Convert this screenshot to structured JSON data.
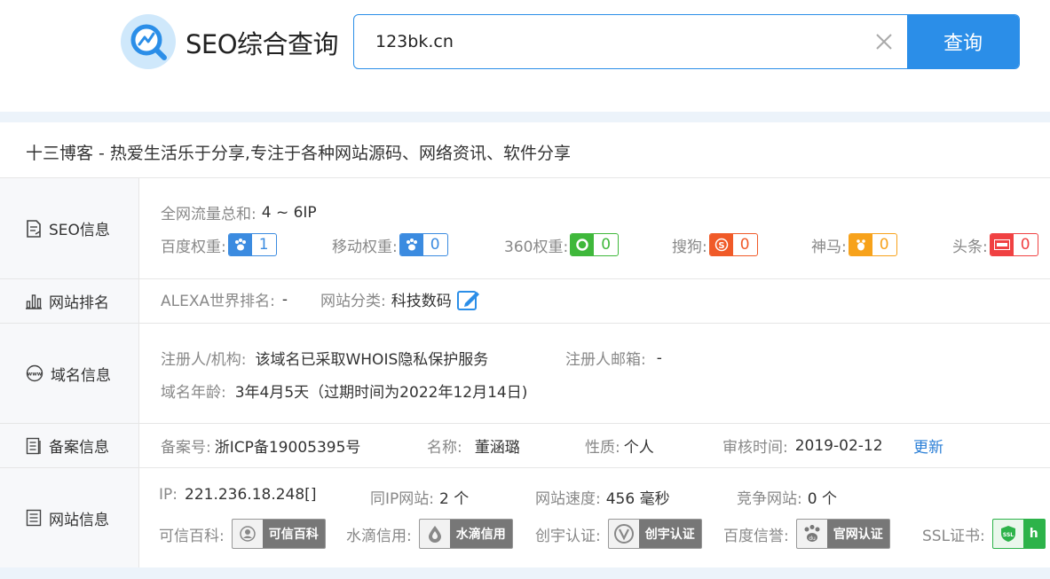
{
  "header": {
    "site_name": "SEO综合查询",
    "search_value": "123bk.cn",
    "search_button": "查询",
    "brand_color": "#2b8ee8"
  },
  "site_title": "十三博客 - 热爱生活乐于分享,专注于各种网站源码、网络资讯、软件分享",
  "seo": {
    "label": "SEO信息",
    "traffic_key": "全网流量总和:",
    "traffic_value": "4 ~ 6IP",
    "weights": [
      {
        "key": "百度权重:",
        "value": "1",
        "icon": "baidu-paw-icon"
      },
      {
        "key": "移动权重:",
        "value": "0",
        "icon": "baidu-paw-icon"
      },
      {
        "key": "360权重:",
        "value": "0",
        "icon": "360-icon"
      },
      {
        "key": "搜狗:",
        "value": "0",
        "icon": "sogou-icon"
      },
      {
        "key": "神马:",
        "value": "0",
        "icon": "shenma-icon"
      },
      {
        "key": "头条:",
        "value": "0",
        "icon": "toutiao-icon"
      }
    ]
  },
  "rank": {
    "label": "网站排名",
    "alexa_key": "ALEXA世界排名:",
    "alexa_value": "-",
    "category_key": "网站分类:",
    "category_value": "科技数码"
  },
  "domain": {
    "label": "域名信息",
    "registrant_key": "注册人/机构:",
    "registrant_value": "该域名已采取WHOIS隐私保护服务",
    "email_key": "注册人邮箱:",
    "email_value": "-",
    "age_key": "域名年龄:",
    "age_value": "3年4月5天（过期时间为2022年12月14日)"
  },
  "icp": {
    "label": "备案信息",
    "number_key": "备案号:",
    "number_value": "浙ICP备19005395号",
    "name_key": "名称:",
    "name_value": "董涵璐",
    "type_key": "性质:",
    "type_value": "个人",
    "audit_key": "审核时间:",
    "audit_value": "2019-02-12",
    "update_link": "更新"
  },
  "site": {
    "label": "网站信息",
    "ip_key": "IP:",
    "ip_value": "221.236.18.248[]",
    "same_ip_key": "同IP网站:",
    "same_ip_value": "2 个",
    "speed_key": "网站速度:",
    "speed_value": "456 毫秒",
    "competitor_key": "竞争网站:",
    "competitor_value": "0 个",
    "certs": [
      {
        "key": "可信百科:",
        "text": "可信百科",
        "icon": "kexin-icon"
      },
      {
        "key": "水滴信用:",
        "text": "水滴信用",
        "icon": "water-drop-icon"
      },
      {
        "key": "创宇认证:",
        "text": "创宇认证",
        "icon": "chuangyu-icon"
      },
      {
        "key": "百度信誉:",
        "text": "官网认证",
        "icon": "baidu-du-icon"
      },
      {
        "key": "SSL证书:",
        "text": "h",
        "icon": "ssl-icon"
      }
    ]
  }
}
